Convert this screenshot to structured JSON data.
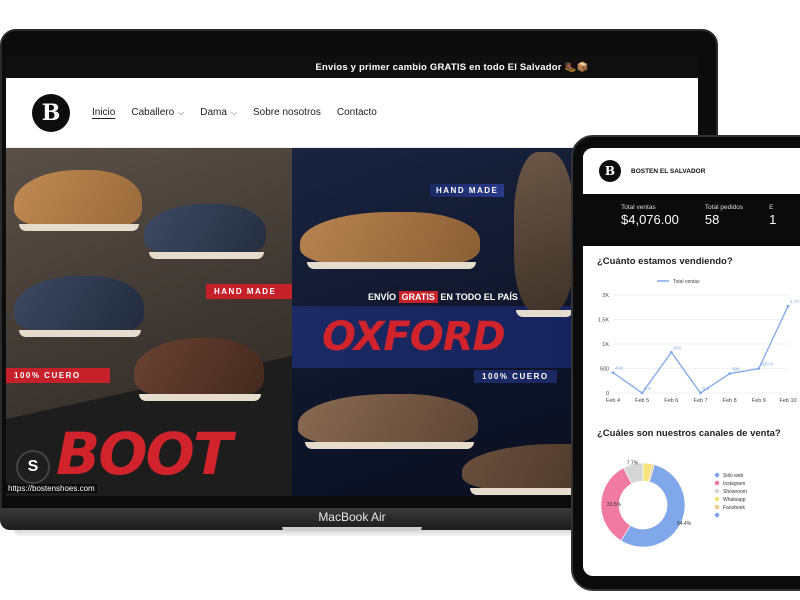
{
  "laptop": {
    "device_label": "MacBook Air",
    "site": {
      "announcement": "Envios y primer cambio GRATIS en todo El Salvador 🥾📦",
      "logo_letter": "B",
      "nav": [
        {
          "label": "Inicio",
          "active": true,
          "has_dropdown": false
        },
        {
          "label": "Caballero",
          "active": false,
          "has_dropdown": true
        },
        {
          "label": "Dama",
          "active": false,
          "has_dropdown": true
        },
        {
          "label": "Sobre nosotros",
          "active": false,
          "has_dropdown": false
        },
        {
          "label": "Contacto",
          "active": false,
          "has_dropdown": false
        }
      ],
      "hero": {
        "left": {
          "tag_handmade": "HAND MADE",
          "tag_cuero": "100% CUERO",
          "headline": "BOOT"
        },
        "right": {
          "tag_handmade": "HAND MADE",
          "envio_prefix": "ENVÍO",
          "envio_gratis": "GRATIS",
          "envio_suffix": "EN TODO EL PAÍS",
          "headline": "OXFORD",
          "tag_cuero": "100% CUERO"
        }
      },
      "url": "https://bostenshoes.com"
    }
  },
  "tablet": {
    "brand": "BOSTEN EL SALVADOR",
    "logo_letter": "B",
    "kpis": [
      {
        "label": "Total ventas",
        "value": "$4,076.00"
      },
      {
        "label": "Total pedidos",
        "value": "58"
      },
      {
        "label": "E",
        "value": "1"
      }
    ],
    "sales_section_title": "¿Cuánto estamos vendiendo?",
    "channels_section_title": "¿Cuáles son nuestros canales de venta?",
    "colors": {
      "line": "#7fa7ea",
      "sitio_web": "#7fa7ea",
      "instagram": "#f07aa2",
      "showroom": "#d6d6d6",
      "whatsapp": "#f6e27a",
      "facebook": "#f6c88c"
    }
  },
  "chart_data": [
    {
      "type": "line",
      "title": "¿Cuánto estamos vendiendo?",
      "legend": [
        "Total ventas"
      ],
      "x": [
        "Feb 4",
        "Feb 5",
        "Feb 6",
        "Feb 7",
        "Feb 8",
        "Feb 9",
        "Feb 10"
      ],
      "series": [
        {
          "name": "Total ventas",
          "values": [
            416,
            0,
            831,
            0,
            396,
            500,
            1771.5
          ]
        }
      ],
      "data_labels": [
        "416",
        "0.0",
        "831",
        "0.0",
        "396",
        "500.0",
        "1,771.5"
      ],
      "yticks": [
        "0",
        "500",
        "1K",
        "1.5K",
        "2K"
      ],
      "ylim": [
        0,
        2000
      ],
      "grid": true
    },
    {
      "type": "pie",
      "title": "¿Cuáles son nuestros canales de venta?",
      "categories": [
        "Sitio web",
        "Instagram",
        "Showroom",
        "Whatsapp",
        "Facebook"
      ],
      "values": [
        54.4,
        33.5,
        7.7,
        3.5,
        0.9
      ],
      "slice_labels": [
        "54.4%",
        "33.5%",
        "7.7%",
        "",
        ""
      ],
      "legend_position": "right",
      "donut": true
    }
  ]
}
